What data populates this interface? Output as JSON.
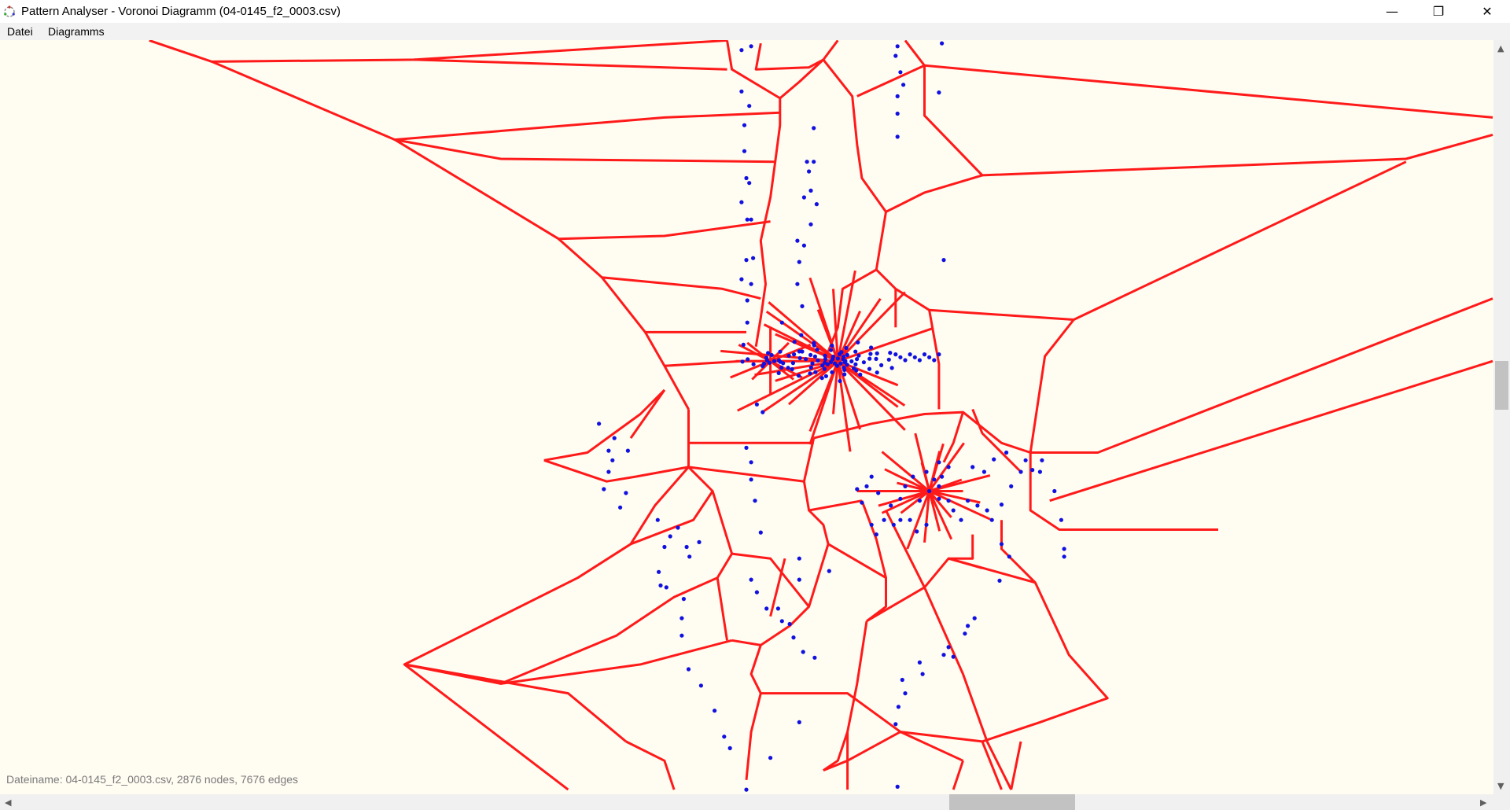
{
  "window": {
    "title": "Pattern Analyser - Voronoi Diagramm (04-0145_f2_0003.csv)",
    "minimize_glyph": "—",
    "maximize_glyph": "❐",
    "close_glyph": "✕"
  },
  "menu": {
    "items": [
      {
        "label": "Datei"
      },
      {
        "label": "Diagramms"
      }
    ]
  },
  "status": {
    "text": "Dateiname: 04-0145_f2_0003.csv, 2876 nodes, 7676 edges"
  },
  "colors": {
    "edge": "#ff1a1a",
    "node": "#1010e0",
    "background": "#fffcf2"
  },
  "icons": {
    "app": "pattern-analyser-icon",
    "scroll_up": "arrow-up-icon",
    "scroll_down": "arrow-down-icon",
    "scroll_left": "arrow-left-icon",
    "scroll_right": "arrow-right-icon"
  },
  "scroll": {
    "up_glyph": "▲",
    "down_glyph": "▼",
    "left_glyph": "◀",
    "right_glyph": "▶"
  }
}
